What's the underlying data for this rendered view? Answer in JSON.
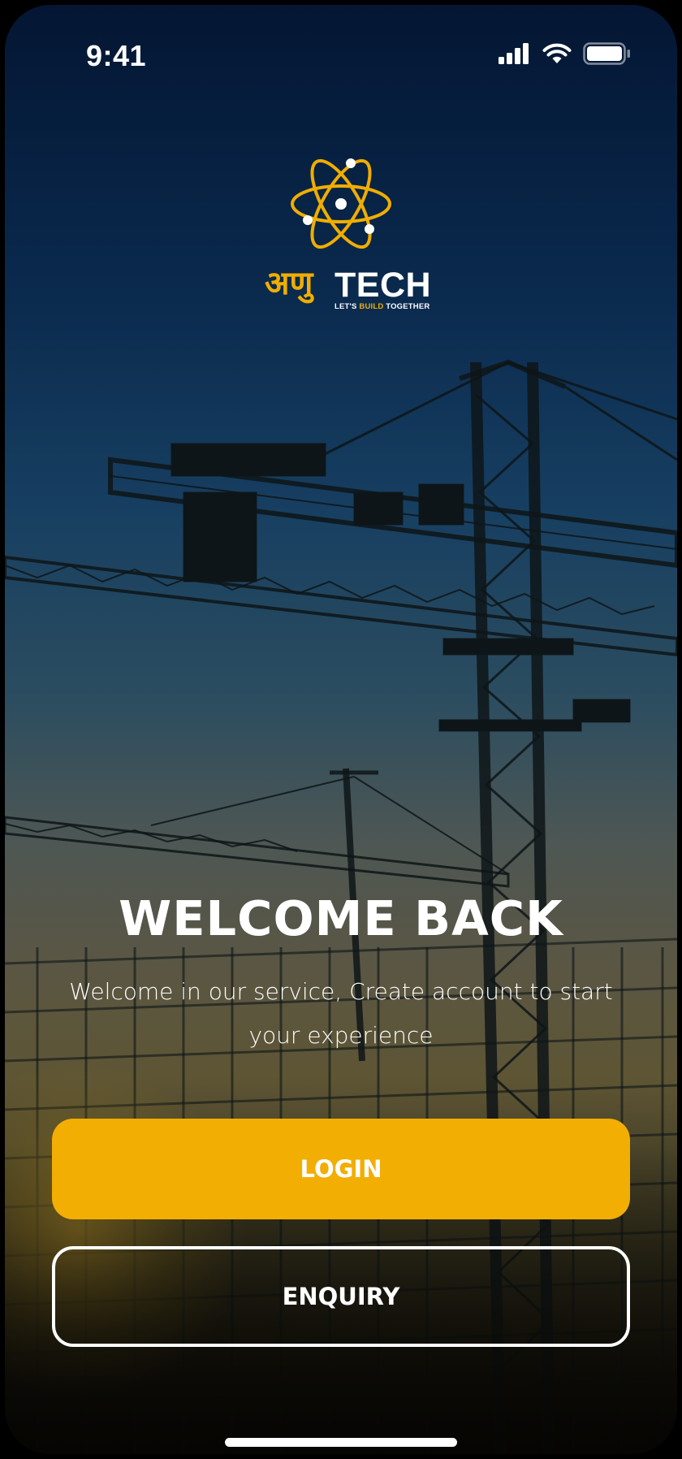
{
  "status_bar": {
    "time": "9:41",
    "icons": [
      "cellular-signal-icon",
      "wifi-icon",
      "battery-icon"
    ]
  },
  "logo": {
    "hindi": "अणु",
    "brand": "TECH",
    "tagline_before": "LET'S ",
    "tagline_accent": "BUILD",
    "tagline_after": " TOGETHER",
    "icon": "atom-icon"
  },
  "welcome": {
    "title": "WELCOME BACK",
    "subtitle": "Welcome in our service, Create account to start your experience"
  },
  "buttons": {
    "login": "LOGIN",
    "enquiry": "ENQUIRY"
  },
  "colors": {
    "accent": "#f2ae02",
    "background_top": "#041633",
    "text": "#ffffff"
  }
}
